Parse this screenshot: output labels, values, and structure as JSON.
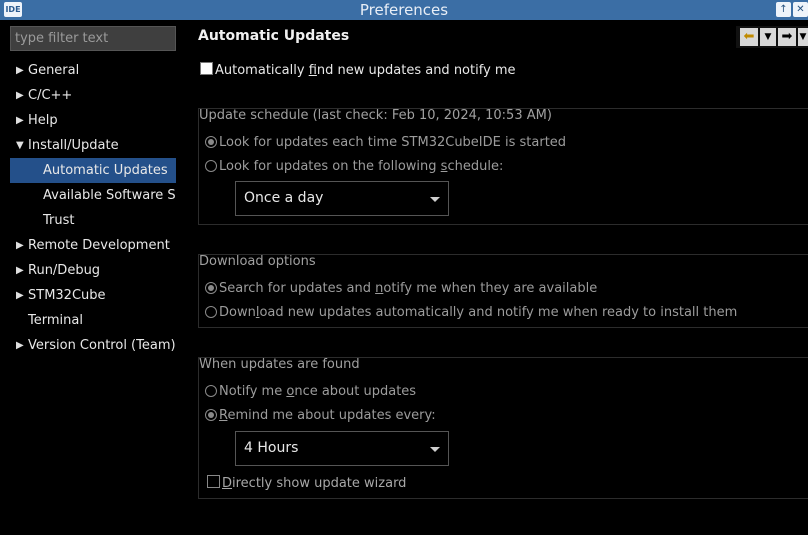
{
  "window": {
    "title": "Preferences",
    "app_icon": "IDE"
  },
  "sidebar": {
    "filter_placeholder": "type filter text",
    "items": [
      {
        "label": "General",
        "expandable": true,
        "expanded": false,
        "level": 0
      },
      {
        "label": "C/C++",
        "expandable": true,
        "expanded": false,
        "level": 0
      },
      {
        "label": "Help",
        "expandable": true,
        "expanded": false,
        "level": 0
      },
      {
        "label": "Install/Update",
        "expandable": true,
        "expanded": true,
        "level": 0
      },
      {
        "label": "Automatic Updates",
        "level": 1,
        "selected": true
      },
      {
        "label": "Available Software Sit",
        "level": 1
      },
      {
        "label": "Trust",
        "level": 1
      },
      {
        "label": "Remote Development",
        "expandable": true,
        "expanded": false,
        "level": 0
      },
      {
        "label": "Run/Debug",
        "expandable": true,
        "expanded": false,
        "level": 0
      },
      {
        "label": "STM32Cube",
        "expandable": true,
        "expanded": false,
        "level": 0
      },
      {
        "label": "Terminal",
        "expandable": false,
        "level": 0
      },
      {
        "label": "Version Control (Team)",
        "expandable": true,
        "expanded": false,
        "level": 0
      }
    ]
  },
  "main": {
    "title": "Automatic Updates",
    "auto_find": {
      "pre": "Automatically ",
      "mnemonic": "f",
      "post": "ind new updates and notify me",
      "checked": false
    },
    "schedule": {
      "title": "Update schedule (last check: Feb 10, 2024, 10:53 AM)",
      "opt1": {
        "label": "Look for updates each time STM32CubeIDE is started",
        "selected": true
      },
      "opt2": {
        "pre": "Look for updates on the following ",
        "mnemonic": "s",
        "post": "chedule:",
        "selected": false
      },
      "frequency": "Once a day"
    },
    "download": {
      "title": "Download options",
      "opt1": {
        "pre": "Search for updates and ",
        "mnemonic": "n",
        "post": "otify me when they are available",
        "selected": true
      },
      "opt2": {
        "pre": "Down",
        "mnemonic": "l",
        "post": "oad new updates automatically and notify me when ready to install them",
        "selected": false
      }
    },
    "found": {
      "title": "When updates are found",
      "opt1": {
        "pre": "Notify me ",
        "mnemonic": "o",
        "post": "nce about updates",
        "selected": false
      },
      "opt2": {
        "pre": "",
        "mnemonic": "R",
        "post": "emind me about updates every:",
        "selected": true
      },
      "interval": "4 Hours",
      "wizard": {
        "pre": "",
        "mnemonic": "D",
        "post": "irectly show update wizard",
        "checked": false
      }
    }
  },
  "colors": {
    "titlebar": "#3b6ea5",
    "selection": "#24508a"
  }
}
